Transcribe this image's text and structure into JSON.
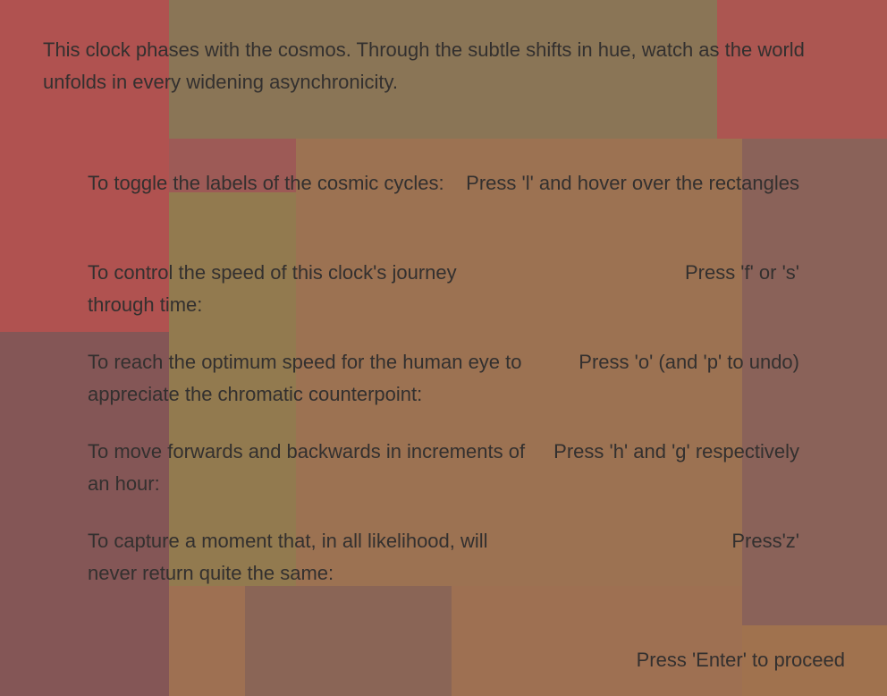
{
  "intro": "This clock phases with the cosmos. Through the subtle shifts in hue, watch as the world unfolds in every widening asynchronicity.",
  "instructions": [
    {
      "label": "To toggle the labels of the cosmic cycles:",
      "key": "Press 'l' and hover over the rectangles"
    },
    {
      "label": "To control the speed of this clock's journey through time:",
      "key": "Press 'f' or 's'"
    },
    {
      "label": "To reach the optimum speed for the human eye to appreciate the chromatic counterpoint:",
      "key": "Press 'o' (and 'p' to undo)"
    },
    {
      "label": "To move forwards and backwards in increments of an hour:",
      "key": "Press 'h' and 'g' respectively"
    },
    {
      "label": "To capture a moment that, in all likelihood, will never return quite the same:",
      "key": "Press'z'"
    }
  ],
  "proceed": "Press 'Enter' to proceed",
  "colors": {
    "red": "#b05250",
    "olive": "#8a7556",
    "brown": "#9c7252",
    "mauve": "#8a6259",
    "plum": "#845656",
    "khaki": "#927a4f",
    "rose": "#9d5a56",
    "orange": "#a0724e",
    "text": "#33302f"
  }
}
